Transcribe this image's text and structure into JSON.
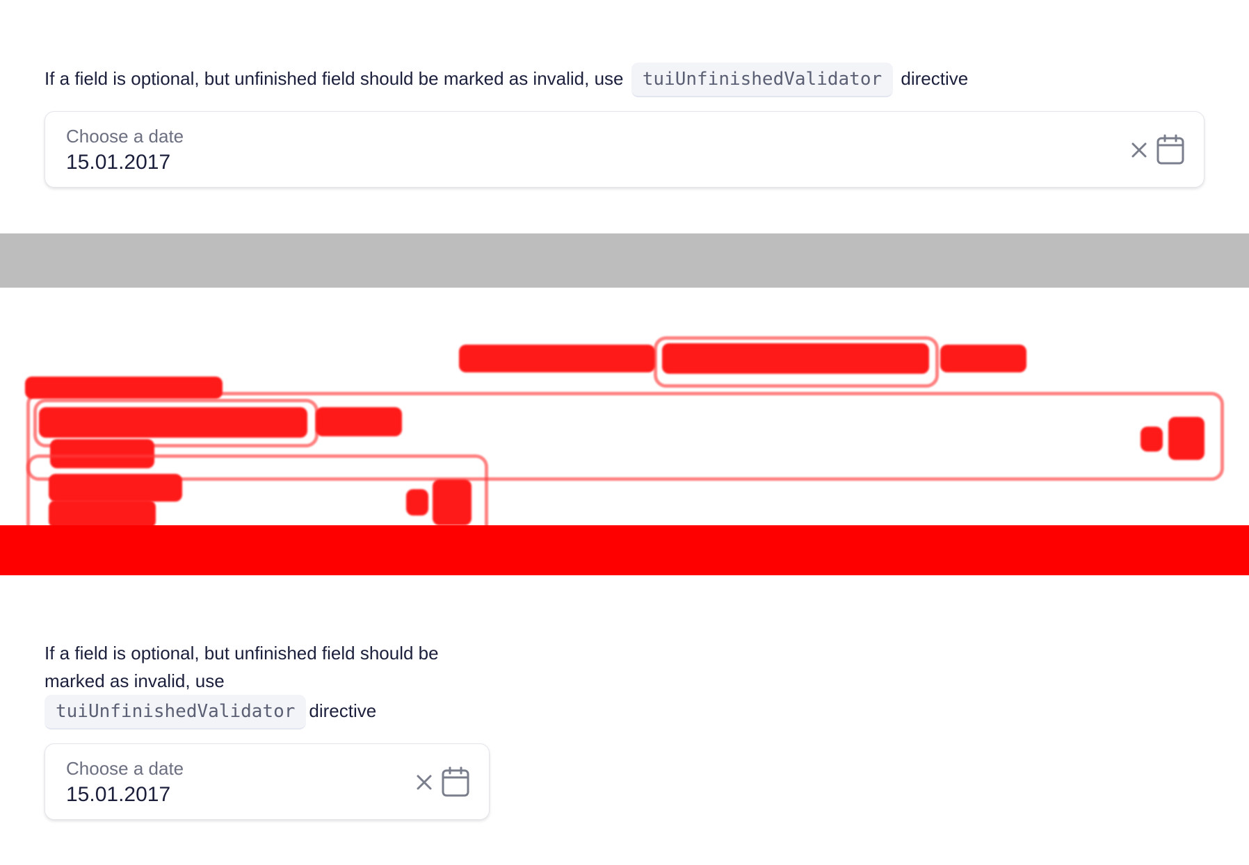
{
  "top_section": {
    "description_before": "If a field is optional, but unfinished field should be marked as invalid, use",
    "code": "tuiUnfinishedValidator",
    "description_after": "directive",
    "field": {
      "label": "Choose a date",
      "value": "15.01.2017"
    }
  },
  "bottom_section": {
    "description_line1": "If a field is optional, but unfinished field should be",
    "description_line2": "marked as invalid, use",
    "code": "tuiUnfinishedValidator",
    "description_after": "directive",
    "field": {
      "label": "Choose a date",
      "value": "15.01.2017"
    }
  },
  "icons": {
    "clear": "close-icon",
    "calendar": "calendar-icon"
  },
  "colors": {
    "diff_red": "#ff0000",
    "separator_gray": "#bdbdbd",
    "text": "#1b1f3b",
    "muted": "#6c6f80"
  }
}
